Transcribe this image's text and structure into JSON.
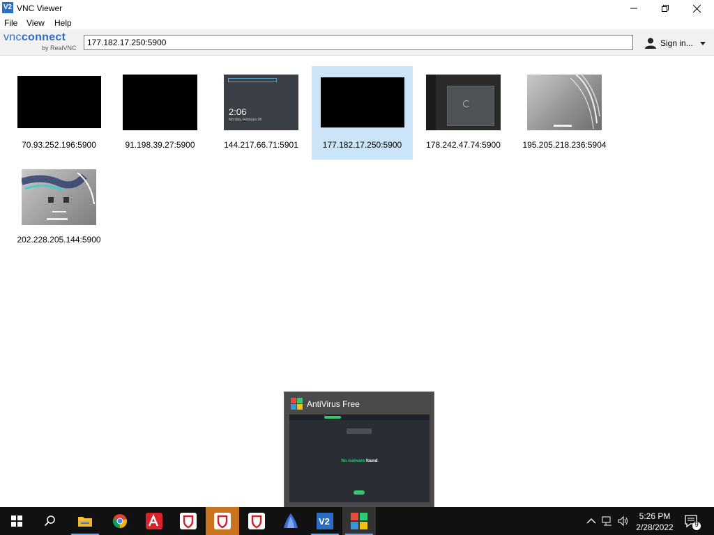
{
  "window": {
    "title": "VNC Viewer",
    "controls": [
      "minimize",
      "maximize",
      "close"
    ]
  },
  "menu": [
    {
      "label": "File"
    },
    {
      "label": "View"
    },
    {
      "label": "Help"
    }
  ],
  "toolbar": {
    "brand_main_light": "vnc",
    "brand_main_bold": "connect",
    "brand_sub": "by RealVNC",
    "address_value": "177.182.17.250:5900",
    "signin_label": "Sign in..."
  },
  "connections": [
    {
      "label": "70.93.252.196:5900",
      "preview": "black"
    },
    {
      "label": "91.198.39.27:5900",
      "preview": "black"
    },
    {
      "label": "144.217.66.71:5901",
      "preview": "lockscreen",
      "time": "2:06",
      "date": "Monday, February 28"
    },
    {
      "label": "177.182.17.250:5900",
      "preview": "black",
      "selected": true
    },
    {
      "label": "178.242.47.74:5900",
      "preview": "dark-desktop"
    },
    {
      "label": "195.205.218.236:5904",
      "preview": "grey-desktop"
    },
    {
      "label": "202.228.205.144:5900",
      "preview": "grey-desktop-icons"
    }
  ],
  "popup": {
    "title": "AntiVirus Free",
    "preview_status_a": "No malware",
    "preview_status_b": " found"
  },
  "taskbar": {
    "apps": [
      "start",
      "search",
      "file-explorer",
      "chrome",
      "avira",
      "vpn-shield",
      "vpn-shield-active",
      "vpn-shield-2",
      "app-blue",
      "vnc-viewer",
      "avg-antivirus"
    ],
    "clock_time": "5:26 PM",
    "clock_date": "2/28/2022",
    "notification_count": "9"
  },
  "colors": {
    "selected_tile": "#cce4f7",
    "brand_blue": "#2b6cc4",
    "active_taskbar": "#c8741c",
    "avg_green": "#35c66f"
  }
}
